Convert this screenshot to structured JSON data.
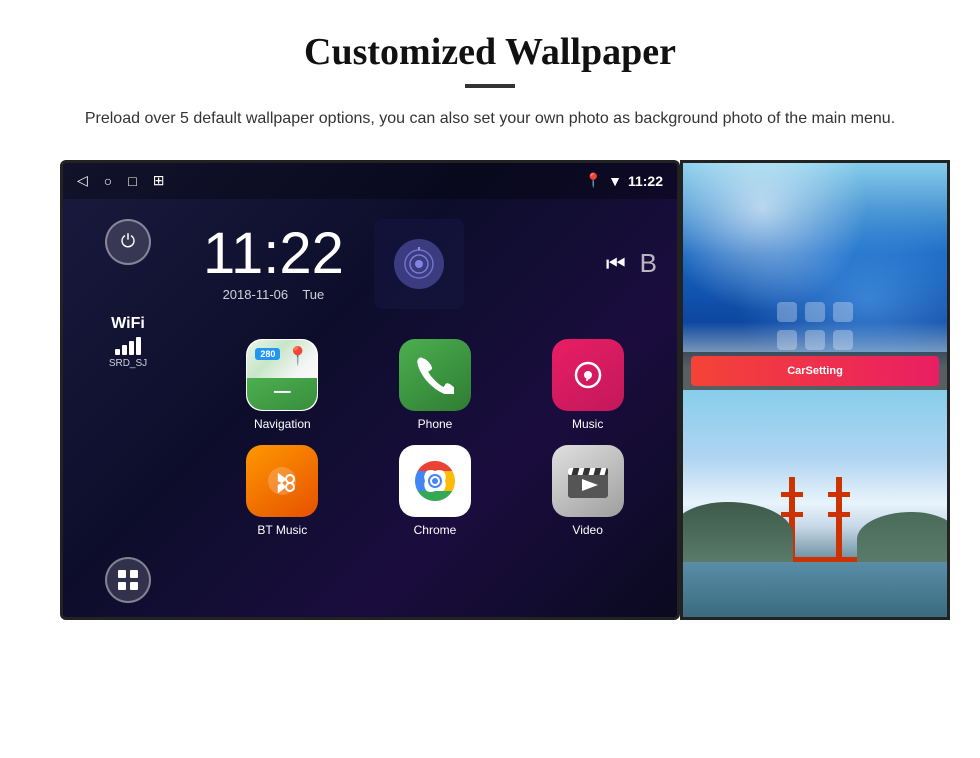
{
  "page": {
    "title": "Customized Wallpaper",
    "description": "Preload over 5 default wallpaper options, you can also set your own photo as background photo of the main menu.",
    "divider": "—"
  },
  "status_bar": {
    "time": "11:22",
    "nav_back": "◁",
    "nav_home": "○",
    "nav_square": "□",
    "nav_photo": "⊞",
    "signal_icon": "▲",
    "wifi_icon": "▼"
  },
  "clock": {
    "time": "11:22",
    "date": "2018-11-06",
    "day": "Tue"
  },
  "sidebar": {
    "power_icon": "⏻",
    "wifi_label": "WiFi",
    "wifi_ssid": "SRD_SJ",
    "apps_icon": "⊞"
  },
  "apps": [
    {
      "id": "navigation",
      "label": "Navigation",
      "badge": "280"
    },
    {
      "id": "phone",
      "label": "Phone"
    },
    {
      "id": "music",
      "label": "Music"
    },
    {
      "id": "btmusic",
      "label": "BT Music"
    },
    {
      "id": "chrome",
      "label": "Chrome"
    },
    {
      "id": "video",
      "label": "Video"
    }
  ],
  "wallpapers": [
    {
      "id": "ice",
      "alt": "Ice cave blue wallpaper"
    },
    {
      "id": "bridge",
      "alt": "Golden Gate Bridge wallpaper"
    }
  ],
  "carsetting": {
    "label": "CarSetting"
  }
}
